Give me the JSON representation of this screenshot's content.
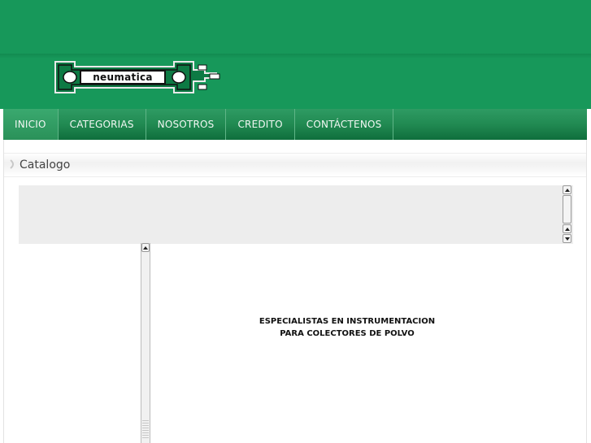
{
  "logo": {
    "text": "neumatica"
  },
  "nav": {
    "items": [
      {
        "label": "INICIO"
      },
      {
        "label": "CATEGORIAS"
      },
      {
        "label": "NOSOTROS"
      },
      {
        "label": "CREDITO"
      },
      {
        "label": "CONTÁCTENOS"
      }
    ]
  },
  "breadcrumb": {
    "title": "Catalogo"
  },
  "content": {
    "tagline_line1": "ESPECIALISTAS EN INSTRUMENTACION",
    "tagline_line2": "PARA COLECTORES DE POLVO"
  },
  "colors": {
    "header_green": "#17985a",
    "nav_green": "#218a52",
    "panel_gray": "#ededed"
  }
}
